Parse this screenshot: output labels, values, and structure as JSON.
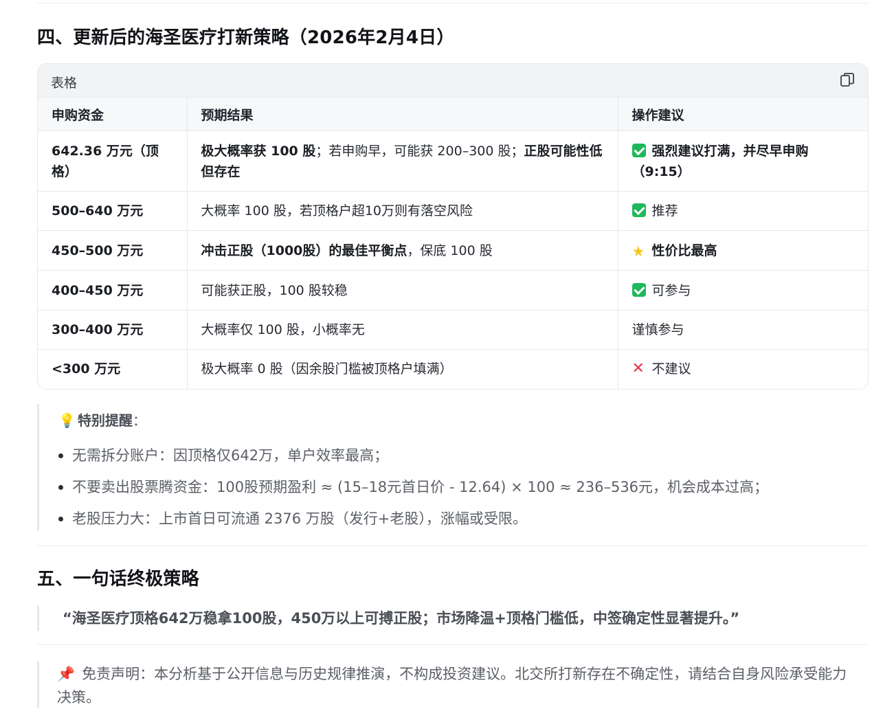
{
  "section4": {
    "heading": "四、更新后的海圣医疗打新策略（2026年2月4日）"
  },
  "table": {
    "title": "表格",
    "copy_icon": "copy-icon",
    "headers": [
      "申购资金",
      "预期结果",
      "操作建议"
    ],
    "rows": [
      {
        "funds": "642.36 万元（顶格）",
        "result_bold1": "极大概率获 100 股",
        "result_text": "；若申购早，可能获 200–300 股；",
        "result_bold2": "正股可能性低但存在",
        "advice_icon": "check-icon",
        "advice": "强烈建议打满，并尽早申购（9:15）"
      },
      {
        "funds": "500–640 万元",
        "result_text": "大概率 100 股，若顶格户超10万则有落空风险",
        "advice_icon": "check-icon",
        "advice": "推荐"
      },
      {
        "funds": "450–500 万元",
        "result_bold1": "冲击正股（1000股）的最佳平衡点",
        "result_text": "，保底 100 股",
        "advice_icon": "star-icon",
        "advice": "性价比最高"
      },
      {
        "funds": "400–450 万元",
        "result_text": "可能获正股，100 股较稳",
        "advice_icon": "check-icon",
        "advice": "可参与"
      },
      {
        "funds": "300–400 万元",
        "result_text": "大概率仅 100 股，小概率无",
        "advice": "谨慎参与"
      },
      {
        "funds": "<300 万元",
        "result_text": "极大概率 0 股（因余股门槛被顶格户填满）",
        "advice_icon": "cross-icon",
        "advice": "不建议"
      }
    ]
  },
  "tip": {
    "icon": "lightbulb-icon",
    "title": "特别提醒",
    "colon": "：",
    "bullets": [
      "无需拆分账户：因顶格仅642万，单户效率最高；",
      "不要卖出股票腾资金：100股预期盈利 ≈ (15–18元首日价 - 12.64) × 100 ≈ 236–536元，机会成本过高；",
      "老股压力大：上市首日可流通 2376 万股（发行+老股），涨幅或受限。"
    ]
  },
  "section5": {
    "heading": "五、一句话终极策略"
  },
  "slogan": "“海圣医疗顶格642万稳拿100股，450万以上可搏正股；市场降温+顶格门槛低，中签确定性显著提升。”",
  "disclaimer": {
    "icon": "pushpin-icon",
    "text": "免责声明：本分析基于公开信息与历史规律推演，不构成投资建议。北交所打新存在不确定性，请结合自身风险承受能力决策。"
  },
  "colors": {
    "check": "#1fb85c",
    "star": "#f5c518",
    "cross": "#e8344a"
  }
}
